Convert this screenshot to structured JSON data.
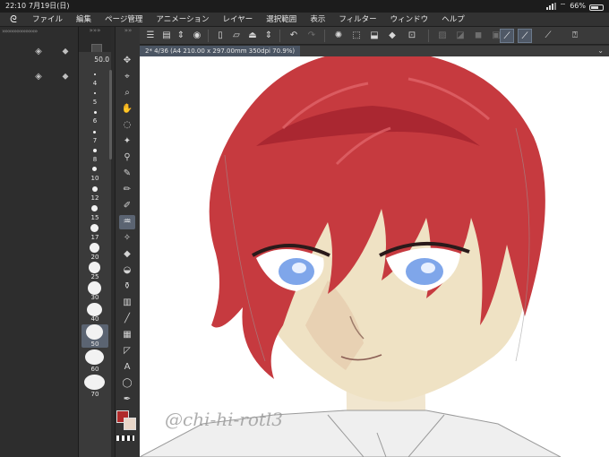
{
  "status_bar": {
    "time": "22:10",
    "date": "7月19日(日)",
    "battery": "66%",
    "battery_level": 0.66
  },
  "menu_bar": {
    "logo_icon": "clip-studio-logo-icon",
    "items": [
      "ファイル",
      "編集",
      "ページ管理",
      "アニメーション",
      "レイヤー",
      "選択範囲",
      "表示",
      "フィルター",
      "ウィンドウ",
      "ヘルプ"
    ]
  },
  "brush_size": {
    "current_value": "50.0",
    "presets": [
      {
        "label": "4"
      },
      {
        "label": "5"
      },
      {
        "label": "6"
      },
      {
        "label": "7"
      },
      {
        "label": "8"
      },
      {
        "label": "10"
      },
      {
        "label": "12"
      },
      {
        "label": "15"
      },
      {
        "label": "17"
      },
      {
        "label": "20"
      },
      {
        "label": "25"
      },
      {
        "label": "30"
      },
      {
        "label": "40"
      },
      {
        "label": "50",
        "selected": true
      },
      {
        "label": "60"
      },
      {
        "label": "70"
      }
    ]
  },
  "document": {
    "tab_label": "2* 4/36 (A4 210.00 x 297.00mm 350dpi 70.9%)"
  },
  "canvas": {
    "signature": "@chi-hi-rotl3"
  },
  "colors": {
    "main_color": "#b02a2a",
    "sub_color": "#e8d6c8",
    "hair": "#c63a3f",
    "hair_shadow": "#9e1f2c",
    "skin": "#efe2c4",
    "eye": "#7fa6ea"
  },
  "tools": [
    "move-icon",
    "object-select-icon",
    "zoom-icon",
    "hand-icon",
    "lasso-icon",
    "auto-select-icon",
    "eyedropper-icon",
    "pen-icon",
    "pencil-icon",
    "marker-icon",
    "blend-icon",
    "sparkle-icon",
    "eraser-icon",
    "fill-icon",
    "decorate-icon",
    "gradient-icon",
    "line-icon",
    "frame-icon",
    "ruler-icon",
    "text-icon",
    "balloon-icon",
    "correction-icon"
  ]
}
